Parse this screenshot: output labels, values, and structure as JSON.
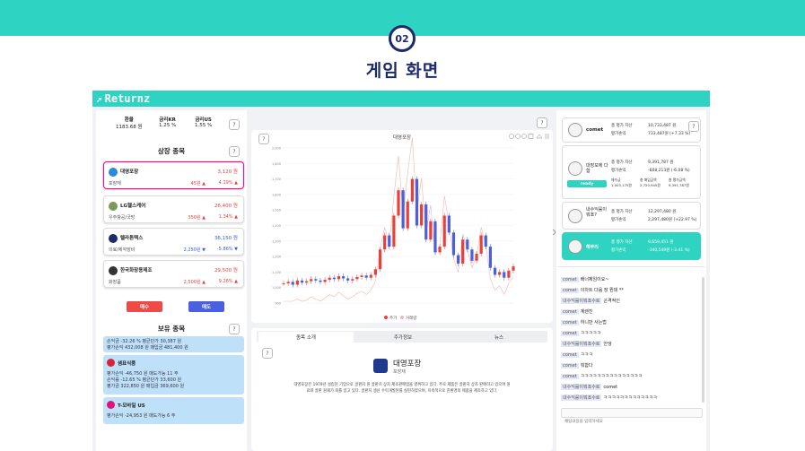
{
  "banner": {
    "badge": "02",
    "title": "게임 화면"
  },
  "app": {
    "title": "Returnz",
    "logo": "↗"
  },
  "left": {
    "indicators": [
      {
        "label": "환율",
        "value": "1183.68 원"
      },
      {
        "label": "금리KR",
        "value": "1.25 %"
      },
      {
        "label": "금리US",
        "value": "1.55 %"
      }
    ],
    "listed_title": "상장 종목",
    "stocks": [
      {
        "name": "대영포장",
        "price": "3,120 원",
        "sector": "포장재",
        "change": "45원 ▲",
        "pct": "4.19% ▲",
        "color": "#e8413a"
      },
      {
        "name": "LG헬스케어",
        "price": "26,400 원",
        "sector": "우주항공/국방",
        "change": "350원 ▲",
        "pct": "1.34% ▲",
        "color": "#e8413a"
      },
      {
        "name": "텔라튼텍스",
        "price": "36,150 원",
        "sector": "의료/제약장비",
        "change": "2,250원 ▼",
        "pct": "-5.86% ▼",
        "color": "#3a5de8"
      },
      {
        "name": "한국화장용제조",
        "price": "29,500 원",
        "sector": "화장품",
        "change": "2,500원 ▲",
        "pct": "9.26% ▲",
        "color": "#e8413a"
      }
    ],
    "buy": "매수",
    "sell": "매도",
    "holdings_title": "보유 종목",
    "holdings": [
      {
        "name": "",
        "lines": [
          "손익금 -32.26 %  평균단가 30,387 원",
          "평가손익 432,008 원  매입금 481,400 원"
        ]
      },
      {
        "name": "샘표식품",
        "lines": [
          "평가손익 -46,750 원  매도가능 11 주",
          "손익률 -12.65 %  평균단가 33,600 원",
          "평가금 322,850 원  매입금 369,600 원"
        ]
      },
      {
        "name": "T-모바일 US",
        "lines": [
          "평가손익 -24,953 원  매도가능 6 주"
        ]
      }
    ]
  },
  "center": {
    "chart_title": "대영포장",
    "tabs": [
      "종목 소개",
      "주가정보",
      "뉴스"
    ],
    "company": "대영포장",
    "company_sector": "포장재",
    "desc1": "대영포장은 1979년 설립된 기업으로 골판지 원 골판지 상자 제조판매업을 영위하고 있다. 주로 제품은 골판지 상자 판매하고 있으며 원",
    "desc2": "료와 골판 원재가 회를 있고 있다. 골판지 생산 수익개발된를 실현하였으며, 지속적으로 친환경의 제품을 제조하고 있다.",
    "legend": [
      "주가",
      "거래량"
    ]
  },
  "chart_data": {
    "type": "line",
    "title": "대영포장",
    "ylim": [
      900,
      2000
    ],
    "y_ticks": [
      "2,000",
      "1,800",
      "1,700",
      "1,600",
      "1,500",
      "1,400",
      "1,300",
      "1,200",
      "1,100",
      "1,000",
      "900"
    ],
    "x": [
      0,
      5,
      10,
      15,
      20,
      25,
      30,
      35,
      40,
      45,
      50,
      55,
      60,
      65,
      70,
      75,
      80,
      85,
      90,
      95,
      100,
      105,
      110,
      115,
      120,
      125,
      130,
      135,
      140,
      145,
      150,
      155,
      160,
      165,
      170,
      175,
      180,
      185,
      190,
      195,
      200,
      205,
      210,
      215,
      220,
      225,
      230,
      235,
      240,
      245,
      250
    ],
    "values": [
      1040,
      1050,
      1030,
      1060,
      1045,
      1055,
      1070,
      1060,
      1050,
      1065,
      1080,
      1070,
      1090,
      1075,
      1060,
      1070,
      1085,
      1095,
      1080,
      1100,
      1140,
      1280,
      1380,
      1300,
      1520,
      1700,
      1430,
      1620,
      1780,
      1450,
      1600,
      1350,
      1480,
      1260,
      1300,
      1520,
      1400,
      1240,
      1180,
      1350,
      1280,
      1200,
      1250,
      1380,
      1300,
      1150,
      1100,
      1120,
      1080,
      1130,
      1160
    ],
    "volume_ylim": [
      0,
      120000000
    ]
  },
  "right": {
    "players": [
      {
        "name": "comet",
        "asset": "10,733,487 원",
        "profit": "733,487원 (+7.33 %)"
      },
      {
        "name": "대장모에 다함",
        "asset": "9,391,787 원",
        "profit": "-608,213원 (-6.08 %)",
        "status": "ready",
        "extra": [
          "매수금 1,003,175원",
          "총 매입금액 2,720,945원",
          "총 평가금액 9,391,787원"
        ]
      },
      {
        "name": "내수익률이뭐죠?",
        "asset": "12,297,480 원",
        "profit": "2,297,480원 (+22.97 %)"
      },
      {
        "name": "해무리",
        "asset": "9,659,451 원",
        "profit": "-340,549원 (-3.41 %)"
      }
    ],
    "labels": [
      "총 평가 자산",
      "평가손익"
    ],
    "chat": [
      {
        "u": "comet",
        "m": "배너제임이요~"
      },
      {
        "u": "comet",
        "m": "이차트 다음 장 뭔데 **"
      },
      {
        "u": "내수익률이뭐죠수로",
        "m": "곤격적인"
      },
      {
        "u": "comet",
        "m": "계렌진"
      },
      {
        "u": "comet",
        "m": "하니만 사는법"
      },
      {
        "u": "comet",
        "m": "ㅋㅋㅋㅋㅋ"
      },
      {
        "u": "내수익률이뭐죠수로",
        "m": "안냉"
      },
      {
        "u": "comet",
        "m": "ㅋㅋㅋ"
      },
      {
        "u": "comet",
        "m": "뭐함다"
      },
      {
        "u": "comet",
        "m": "ㅋㅋㅋㅋㅋㅋㅋㅋㅋㅋㅋㅋㅋㅋㅋ"
      },
      {
        "u": "내수익률이뭐죠수로",
        "m": "comet"
      },
      {
        "u": "내수익률이뭐죠수로",
        "m": "ㅋㅋㅋㅋㅋㅋㅋㅋㅋㅋㅋㅋㅋ"
      }
    ],
    "chat_placeholder": "채팅내용을 입력하세요"
  }
}
